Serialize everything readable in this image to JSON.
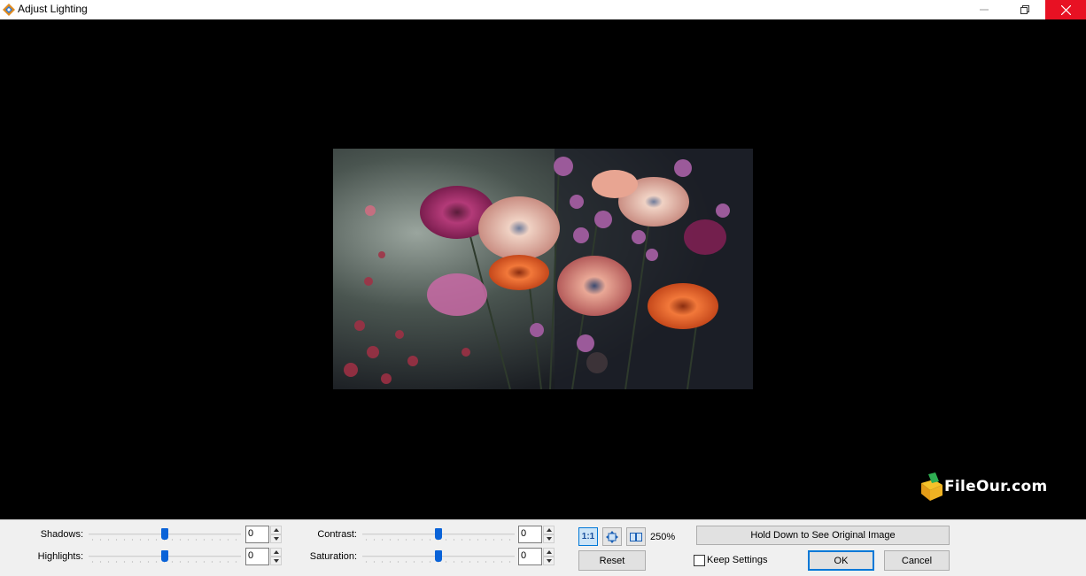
{
  "window": {
    "title": "Adjust Lighting",
    "icon": "app-logo-icon",
    "controls": [
      "minimize-icon",
      "restore-icon",
      "close-icon"
    ]
  },
  "watermark": {
    "text": "FileOur.com"
  },
  "adjustments": {
    "shadows": {
      "label": "Shadows:",
      "value": "0",
      "level": 0.5
    },
    "highlights": {
      "label": "Highlights:",
      "value": "0",
      "level": 0.5
    },
    "contrast": {
      "label": "Contrast:",
      "value": "0",
      "level": 0.5
    },
    "saturation": {
      "label": "Saturation:",
      "value": "0",
      "level": 0.5
    }
  },
  "view": {
    "actual_size_label": "1:1",
    "fit_icon": "fit-to-window-icon",
    "compare_icon": "split-view-icon",
    "zoom": "250%"
  },
  "buttons": {
    "hold_original": "Hold Down to See Original Image",
    "reset": "Reset",
    "ok": "OK",
    "cancel": "Cancel"
  },
  "keep_settings": {
    "label": "Keep Settings",
    "checked": false
  },
  "colors": {
    "accent": "#0a63d8",
    "close_red": "#e81123",
    "panel_bg": "#f0f0f0"
  }
}
